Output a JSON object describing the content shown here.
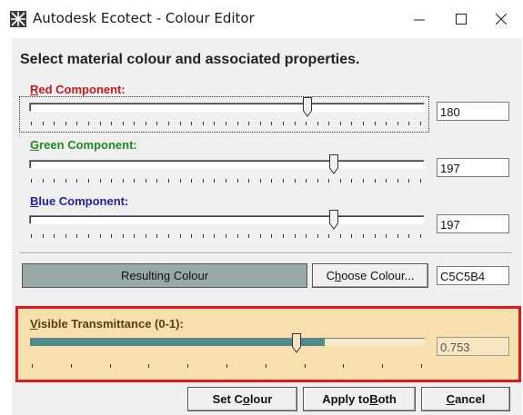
{
  "window": {
    "title": "Autodesk Ecotect - Colour Editor",
    "minimize_label": "—",
    "maximize_label": "☐",
    "close_label": "✕"
  },
  "heading": "Select material colour and associated properties.",
  "red": {
    "label_first": "R",
    "label_rest": "ed Component:",
    "value": "180",
    "level": 0.706,
    "color": "#c81818"
  },
  "green": {
    "label_first": "G",
    "label_rest": "reen Component:",
    "value": "197",
    "level": 0.773,
    "color": "#1f8a1f"
  },
  "blue": {
    "label_first": "B",
    "label_rest": "lue Component:",
    "value": "197",
    "level": 0.773,
    "color": "#1f1fb0"
  },
  "result": {
    "label": "Resulting Colour",
    "swatch_color": "#99a8a8",
    "choose_pre": "C",
    "choose_ul": "h",
    "choose_post": "oose Colour...",
    "hex": "C5C5B4"
  },
  "transmittance": {
    "label_first": "V",
    "label_rest": "isible Transmittance (0-1):",
    "value": "0.753",
    "level": 0.753,
    "highlight_color": "#e11b1b"
  },
  "buttons": {
    "set_pre": "Set C",
    "set_ul": "o",
    "set_post": "lour",
    "apply_pre": "Apply to ",
    "apply_ul": "B",
    "apply_post": "oth",
    "cancel_ul": "C",
    "cancel_post": "ancel"
  },
  "icons": {
    "app": "ecotect-app-icon"
  }
}
